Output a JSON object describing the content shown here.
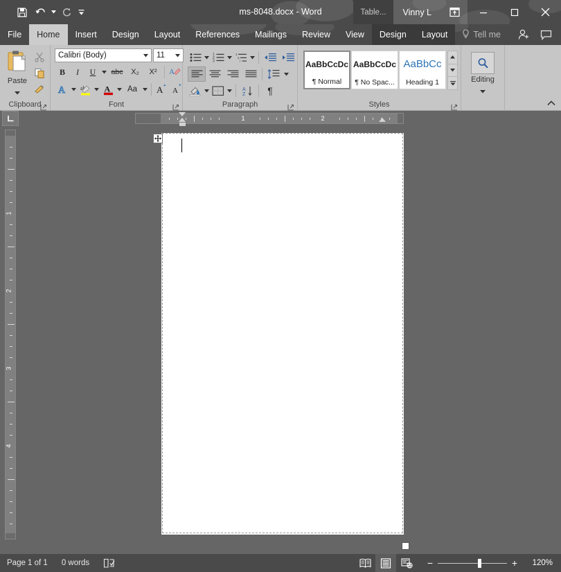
{
  "window": {
    "title": "ms-8048.docx - Word",
    "contextual_tools_label": "Table...",
    "user": "Vinny L",
    "qat": [
      {
        "name": "save",
        "icon": "save-icon"
      },
      {
        "name": "undo",
        "icon": "undo-icon"
      },
      {
        "name": "redo",
        "icon": "redo-icon"
      },
      {
        "name": "customize",
        "icon": "chevron-down-icon"
      }
    ],
    "buttons": {
      "ribbon_display": "ribbon-display-options-icon",
      "minimize": "minimize-icon",
      "maximize": "maximize-icon",
      "close": "close-icon"
    }
  },
  "tabs": [
    {
      "label": "File",
      "active": false,
      "contextual": false
    },
    {
      "label": "Home",
      "active": true,
      "contextual": false
    },
    {
      "label": "Insert",
      "active": false,
      "contextual": false
    },
    {
      "label": "Design",
      "active": false,
      "contextual": false
    },
    {
      "label": "Layout",
      "active": false,
      "contextual": false
    },
    {
      "label": "References",
      "active": false,
      "contextual": false
    },
    {
      "label": "Mailings",
      "active": false,
      "contextual": false
    },
    {
      "label": "Review",
      "active": false,
      "contextual": false
    },
    {
      "label": "View",
      "active": false,
      "contextual": false
    },
    {
      "label": "Design",
      "active": false,
      "contextual": true
    },
    {
      "label": "Layout",
      "active": false,
      "contextual": true
    }
  ],
  "tell_me": {
    "label": "Tell me",
    "icon": "lightbulb-icon"
  },
  "title_bar_icons": [
    {
      "name": "share-person-icon"
    },
    {
      "name": "comments-icon"
    }
  ],
  "ribbon": {
    "groups": [
      {
        "label": "Clipboard",
        "has_launcher": true
      },
      {
        "label": "Font",
        "has_launcher": true
      },
      {
        "label": "Paragraph",
        "has_launcher": true
      },
      {
        "label": "Styles",
        "has_launcher": true
      },
      {
        "label": "Editing",
        "has_launcher": false
      }
    ],
    "clipboard": {
      "paste_label": "Paste",
      "items": [
        {
          "name": "cut",
          "icon": "scissors-icon"
        },
        {
          "name": "copy",
          "icon": "copy-icon"
        },
        {
          "name": "format-painter",
          "icon": "paintbrush-icon"
        }
      ]
    },
    "font": {
      "font_name": "Calibri (Body)",
      "font_size": "11",
      "buttons": [
        {
          "name": "bold",
          "label": "B"
        },
        {
          "name": "italic",
          "label": "I"
        },
        {
          "name": "underline",
          "label": "U"
        },
        {
          "name": "strikethrough",
          "label": "abc"
        },
        {
          "name": "subscript",
          "label": "X₂"
        },
        {
          "name": "superscript",
          "label": "X²"
        },
        {
          "name": "clear-formatting",
          "label": "A"
        },
        {
          "name": "text-effects",
          "label": "A"
        },
        {
          "name": "text-highlight-color",
          "label": "ab"
        },
        {
          "name": "font-color",
          "label": "A"
        },
        {
          "name": "change-case",
          "label": "Aa"
        },
        {
          "name": "grow-font",
          "label": "A"
        },
        {
          "name": "shrink-font",
          "label": "A"
        }
      ]
    },
    "paragraph": {
      "buttons": [
        {
          "name": "bullets"
        },
        {
          "name": "numbering"
        },
        {
          "name": "multilevel-list"
        },
        {
          "name": "decrease-indent"
        },
        {
          "name": "increase-indent"
        },
        {
          "name": "align-left",
          "active": true
        },
        {
          "name": "align-center"
        },
        {
          "name": "align-right"
        },
        {
          "name": "justify"
        },
        {
          "name": "line-spacing"
        },
        {
          "name": "shading"
        },
        {
          "name": "borders"
        },
        {
          "name": "sort"
        },
        {
          "name": "show-formatting-marks",
          "label": "¶"
        }
      ]
    },
    "styles": {
      "gallery": [
        {
          "preview": "AaBbCcDc",
          "name": "¶ Normal",
          "selected": true,
          "kind": "body"
        },
        {
          "preview": "AaBbCcDc",
          "name": "¶ No Spac...",
          "selected": false,
          "kind": "body"
        },
        {
          "preview": "AaBbCc",
          "name": "Heading 1",
          "selected": false,
          "kind": "heading"
        }
      ]
    },
    "editing": {
      "label": "Editing",
      "icon": "magnifier-icon"
    },
    "collapse_icon": "chevron-up-icon"
  },
  "ruler": {
    "tab_stop_selector": "left-tab-stop-icon",
    "horizontal_labels": [
      "1",
      "2"
    ],
    "vertical_labels": [
      "1",
      "2",
      "3",
      "4"
    ]
  },
  "document": {
    "has_table": true,
    "table_move_handle": "move-handle-icon",
    "table_resize_handle": "resize-handle-icon",
    "content": ""
  },
  "status_bar": {
    "page": "Page 1 of 1",
    "words": "0 words",
    "proofing_icon": "proofing-errors-icon",
    "views": [
      {
        "name": "read-mode",
        "active": false
      },
      {
        "name": "print-layout",
        "active": true
      },
      {
        "name": "web-layout",
        "active": false
      }
    ],
    "zoom_out": "−",
    "zoom_in": "+",
    "zoom_level": "120%"
  },
  "colors": {
    "titlebar": "#4a4a4a",
    "tabbar": "#4a4a4a",
    "ribbon": "#c6c6c6",
    "active_tab_bg": "#cccccc",
    "workspace": "#666666",
    "page": "#ffffff",
    "statusbar": "#4a4a4a",
    "heading_blue": "#2e74b5"
  }
}
